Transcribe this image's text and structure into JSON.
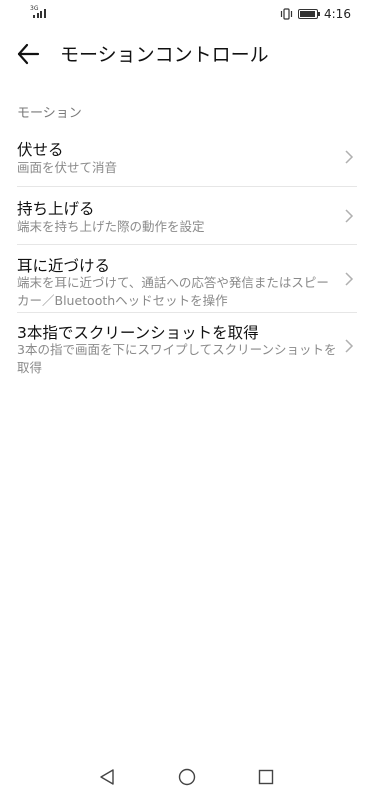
{
  "status_bar": {
    "network": "3G",
    "time": "4:16",
    "icons": [
      "signal-icon",
      "vibrate-icon",
      "battery-icon"
    ]
  },
  "header": {
    "title": "モーションコントロール",
    "back_icon": "arrow-left-icon"
  },
  "section": {
    "label": "モーション"
  },
  "items": [
    {
      "title": "伏せる",
      "subtitle": "画面を伏せて消音"
    },
    {
      "title": "持ち上げる",
      "subtitle": "端末を持ち上げた際の動作を設定"
    },
    {
      "title": "耳に近づける",
      "subtitle": "端末を耳に近づけて、通話への応答や発信またはスピーカー／Bluetoothヘッドセットを操作"
    },
    {
      "title": "3本指でスクリーンショットを取得",
      "subtitle": "3本の指で画面を下にスワイプしてスクリーンショットを取得"
    }
  ],
  "nav": {
    "icons": [
      "triangle-back-icon",
      "circle-home-icon",
      "square-recents-icon"
    ]
  },
  "colors": {
    "title_text": "#111111",
    "subtitle_text": "#8a8a8a",
    "section_text": "#7a7a7a",
    "divider": "#e6e6e6"
  }
}
